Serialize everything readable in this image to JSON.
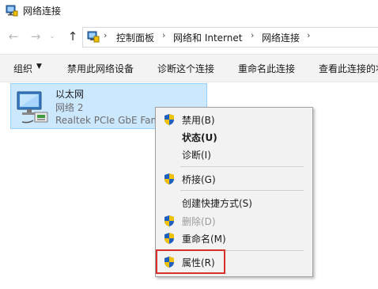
{
  "window": {
    "title": "网络连接"
  },
  "nav": {
    "back_icon": "back-arrow-icon",
    "forward_icon": "forward-arrow-icon",
    "recent_icon": "chevron-down-icon",
    "up_icon": "up-arrow-icon"
  },
  "breadcrumb": [
    "控制面板",
    "网络和 Internet",
    "网络连接"
  ],
  "toolbar": {
    "organize": "组织",
    "disable": "禁用此网络设备",
    "diagnose": "诊断这个连接",
    "rename": "重命名此连接",
    "view_status": "查看此连接的状态"
  },
  "adapter": {
    "name": "以太网",
    "network": "网络 2",
    "device": "Realtek PCIe GbE Family Controller"
  },
  "context_menu": {
    "disable": "禁用(B)",
    "status": "状态(U)",
    "diagnose": "诊断(I)",
    "bridge": "桥接(G)",
    "shortcut": "创建快捷方式(S)",
    "delete": "删除(D)",
    "rename": "重命名(M)",
    "properties": "属性(R)"
  },
  "colors": {
    "selection_bg": "#cce8ff",
    "selection_border": "#99d1ff",
    "highlight_box": "#d9302c",
    "shield_blue": "#1f5fbf",
    "shield_yellow": "#f2c200"
  }
}
